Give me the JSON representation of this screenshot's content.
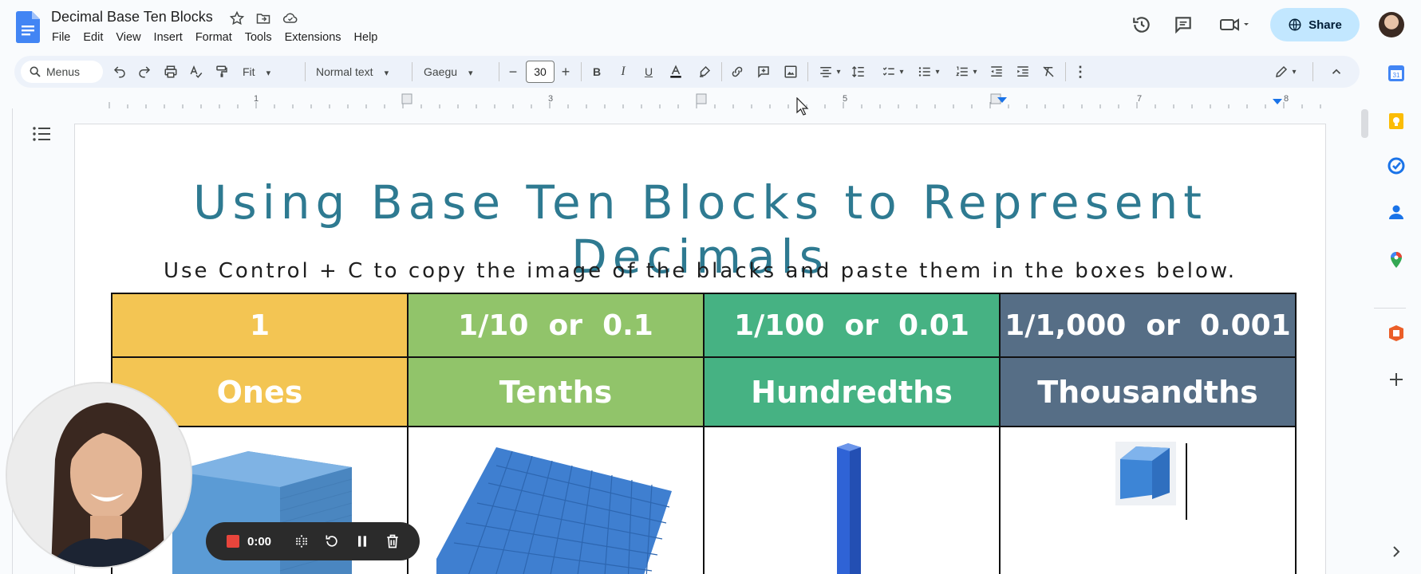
{
  "doc": {
    "title": "Decimal Base Ten Blocks",
    "menu": [
      "File",
      "Edit",
      "View",
      "Insert",
      "Format",
      "Tools",
      "Extensions",
      "Help"
    ],
    "share_label": "Share"
  },
  "toolbar": {
    "menus_label": "Menus",
    "zoom": "Fit",
    "style": "Normal text",
    "font": "Gaegu",
    "font_size": "30"
  },
  "ruler": {
    "ticks": [
      "1",
      "3",
      "5",
      "7",
      "8"
    ]
  },
  "page": {
    "heading": "Using Base Ten Blocks to Represent Decimals",
    "instruction": "Use Control + C to copy the image of the blacks and paste them in the boxes below.",
    "columns": [
      {
        "value": "1",
        "name": "Ones"
      },
      {
        "value": "1/10  or  0.1",
        "name": "Tenths"
      },
      {
        "value": "1/100  or  0.01",
        "name": "Hundredths"
      },
      {
        "value": "1/1,000  or  0.001",
        "name": "Thousandths"
      }
    ]
  },
  "recorder": {
    "time": "0:00"
  },
  "colors": {
    "ones": "#f3c553",
    "tenths": "#91c46a",
    "hundredths": "#46b283",
    "thousandths": "#566e86",
    "heading": "#2e7a91",
    "share_bg": "#c2e7ff"
  }
}
